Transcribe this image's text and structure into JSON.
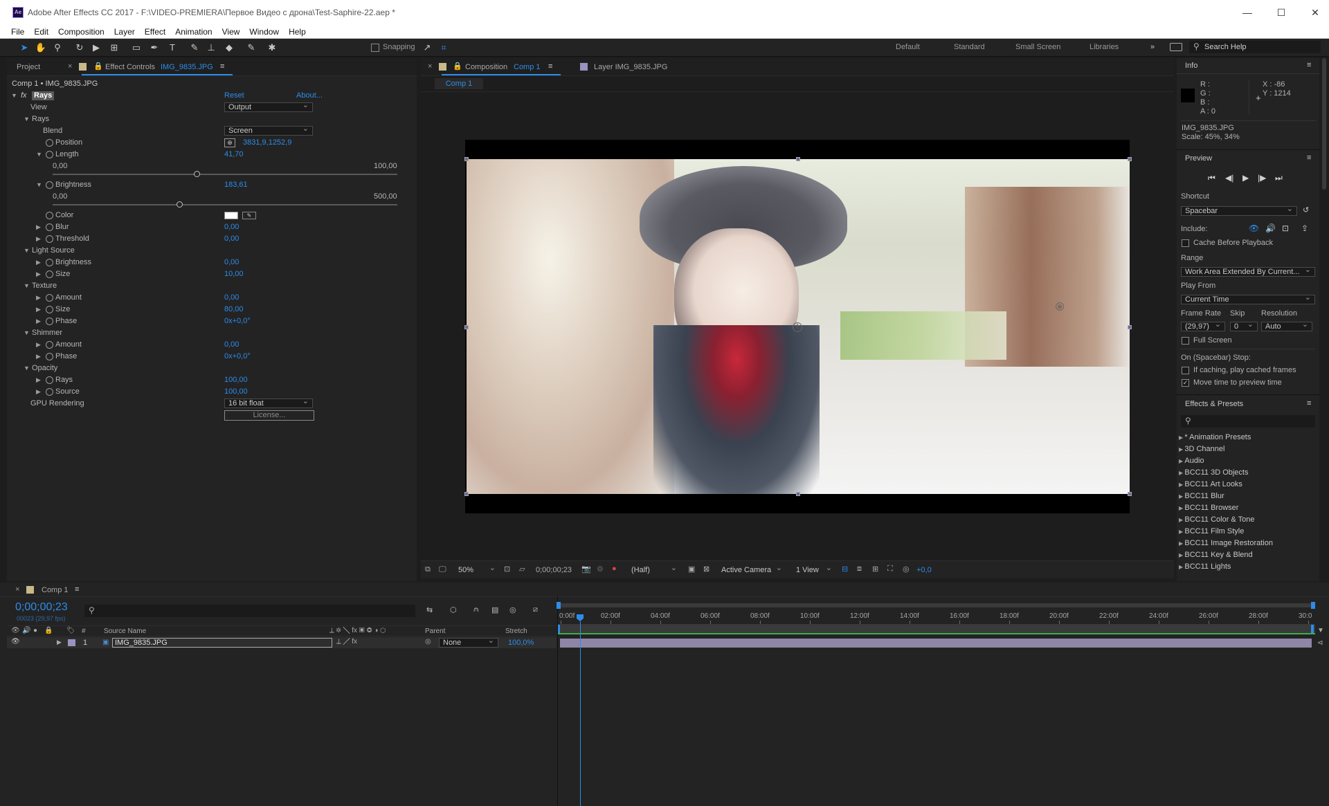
{
  "window": {
    "title": "Adobe After Effects CC 2017 - F:\\VIDEO-PREMIERA\\Первое Видео с дрона\\Test-Saphire-22.aep *",
    "logo": "Ae"
  },
  "menu": [
    "File",
    "Edit",
    "Composition",
    "Layer",
    "Effect",
    "Animation",
    "View",
    "Window",
    "Help"
  ],
  "toolbar": {
    "snapping": "Snapping",
    "workspaces": [
      "Default",
      "Standard",
      "Small Screen",
      "Libraries"
    ],
    "search_help": "Search Help"
  },
  "left_panel": {
    "tab_project": "Project",
    "tab_effect_controls": "Effect Controls",
    "effect_controls_layer": "IMG_9835.JPG",
    "header": "Comp 1 • IMG_9835.JPG",
    "effect_name": "Rays",
    "fx": "fx",
    "reset": "Reset",
    "about": "About...",
    "view_label": "View",
    "view_value": "Output",
    "rays_group": "Rays",
    "blend_label": "Blend",
    "blend_value": "Screen",
    "position_label": "Position",
    "position_value": "3831,9,1252,9",
    "length_label": "Length",
    "length_value": "41,70",
    "length_min": "0,00",
    "length_max": "100,00",
    "length_fraction": 0.417,
    "brightness_label": "Brightness",
    "brightness_value": "183,61",
    "brightness_min": "0,00",
    "brightness_max": "500,00",
    "brightness_fraction": 0.367,
    "color_label": "Color",
    "blur_label": "Blur",
    "blur_value": "0,00",
    "threshold_label": "Threshold",
    "threshold_value": "0,00",
    "light_source": "Light Source",
    "ls_brightness_label": "Brightness",
    "ls_brightness_value": "0,00",
    "ls_size_label": "Size",
    "ls_size_value": "10,00",
    "texture": "Texture",
    "tx_amount_label": "Amount",
    "tx_amount_value": "0,00",
    "tx_size_label": "Size",
    "tx_size_value": "80,00",
    "tx_phase_label": "Phase",
    "tx_phase_value": "0x+0,0°",
    "shimmer": "Shimmer",
    "sh_amount_label": "Amount",
    "sh_amount_value": "0,00",
    "sh_phase_label": "Phase",
    "sh_phase_value": "0x+0,0°",
    "opacity": "Opacity",
    "op_rays_label": "Rays",
    "op_rays_value": "100,00",
    "op_source_label": "Source",
    "op_source_value": "100,00",
    "gpu_label": "GPU Rendering",
    "gpu_value": "16 bit float",
    "license": "License..."
  },
  "comp_panel": {
    "tab_composition": "Composition",
    "comp_name": "Comp 1",
    "tab_layer": "Layer IMG_9835.JPG",
    "breadcrumb": "Comp 1",
    "zoom": "50%",
    "timecode": "0;00;00;23",
    "resolution": "(Half)",
    "camera": "Active Camera",
    "views": "1 View",
    "exposure": "+0,0"
  },
  "info_panel": {
    "title": "Info",
    "r": "R :",
    "g": "G :",
    "b": "B :",
    "a": "A : 0",
    "x": "X : -86",
    "y": "Y : 1214",
    "file": "IMG_9835.JPG",
    "scale": "Scale: 45%, 34%"
  },
  "preview_panel": {
    "title": "Preview",
    "shortcut_label": "Shortcut",
    "shortcut_value": "Spacebar",
    "include_label": "Include:",
    "cache": "Cache Before Playback",
    "range_label": "Range",
    "range_value": "Work Area Extended By Current...",
    "play_from_label": "Play From",
    "play_from_value": "Current Time",
    "frame_rate_label": "Frame Rate",
    "skip_label": "Skip",
    "resolution_label": "Resolution",
    "frame_rate_value": "(29,97)",
    "skip_value": "0",
    "resolution_value": "Auto",
    "full_screen": "Full Screen",
    "on_stop": "On (Spacebar) Stop:",
    "if_caching": "If caching, play cached frames",
    "move_time": "Move time to preview time"
  },
  "effects_panel": {
    "title": "Effects & Presets",
    "items": [
      "* Animation Presets",
      "3D Channel",
      "Audio",
      "BCC11 3D Objects",
      "BCC11 Art Looks",
      "BCC11 Blur",
      "BCC11 Browser",
      "BCC11 Color & Tone",
      "BCC11 Film Style",
      "BCC11 Image Restoration",
      "BCC11 Key & Blend",
      "BCC11 Lights"
    ]
  },
  "timeline": {
    "comp_tab": "Comp 1",
    "timecode": "0;00;00;23",
    "fps": "00023 (29,97 fps)",
    "col_num": "#",
    "col_source": "Source Name",
    "col_parent": "Parent",
    "col_stretch": "Stretch",
    "layer_num": "1",
    "layer_name": "IMG_9835.JPG",
    "layer_parent": "None",
    "layer_stretch": "100,0%",
    "ticks": [
      "0:00f",
      "02:00f",
      "04:00f",
      "06:00f",
      "08:00f",
      "10:00f",
      "12:00f",
      "14:00f",
      "16:00f",
      "18:00f",
      "20:00f",
      "22:00f",
      "24:00f",
      "26:00f",
      "28:00f",
      "30:0"
    ]
  },
  "colors": {
    "accent": "#2d8ceb",
    "panel": "#232323",
    "layer_bar": "#8e86a6"
  }
}
